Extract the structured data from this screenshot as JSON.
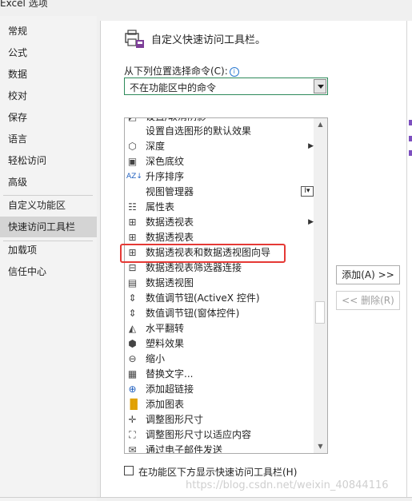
{
  "window": {
    "title": "Excel 选项"
  },
  "sidebar": {
    "items": [
      {
        "label": "常规"
      },
      {
        "label": "公式"
      },
      {
        "label": "数据"
      },
      {
        "label": "校对"
      },
      {
        "label": "保存"
      },
      {
        "label": "语言"
      },
      {
        "label": "轻松访问"
      },
      {
        "label": "高级"
      },
      {
        "label": "自定义功能区"
      },
      {
        "label": "快速访问工具栏",
        "selected": true
      },
      {
        "label": "加载项"
      },
      {
        "label": "信任中心"
      }
    ]
  },
  "main": {
    "heading": "自定义快速访问工具栏。",
    "choose_label": "从下列位置选择命令(C):",
    "dropdown_value": "不在功能区中的命令",
    "commands": [
      {
        "label": "设置/取消阴影",
        "icon": "shadow-icon"
      },
      {
        "label": "设置自选图形的默认效果",
        "icon": "none"
      },
      {
        "label": "深度",
        "icon": "depth-icon",
        "submenu": true
      },
      {
        "label": "深色底纹",
        "icon": "dark-shading-icon"
      },
      {
        "label": "升序排序",
        "icon": "sort-ascending-icon"
      },
      {
        "label": "视图管理器",
        "icon": "none",
        "combo": true
      },
      {
        "label": "属性表",
        "icon": "property-sheet-icon"
      },
      {
        "label": "数据透视表",
        "icon": "pivot-table-icon",
        "submenu": true
      },
      {
        "label": "数据透视表",
        "icon": "pivot-table-icon"
      },
      {
        "label": "数据透视表和数据透视图向导",
        "icon": "pivot-wizard-icon",
        "highlighted": true
      },
      {
        "label": "数据透视表筛选器连接",
        "icon": "pivot-filter-icon"
      },
      {
        "label": "数据透视图",
        "icon": "pivot-chart-icon"
      },
      {
        "label": "数值调节钮(ActiveX 控件)",
        "icon": "spin-button-icon"
      },
      {
        "label": "数值调节钮(窗体控件)",
        "icon": "spin-button-icon"
      },
      {
        "label": "水平翻转",
        "icon": "flip-horizontal-icon"
      },
      {
        "label": "塑料效果",
        "icon": "plastic-effect-icon"
      },
      {
        "label": "缩小",
        "icon": "zoom-out-icon"
      },
      {
        "label": "替换文字...",
        "icon": "alt-text-icon"
      },
      {
        "label": "添加超链接",
        "icon": "hyperlink-icon"
      },
      {
        "label": "添加图表",
        "icon": "chart-icon"
      },
      {
        "label": "调整图形尺寸",
        "icon": "resize-icon"
      },
      {
        "label": "调整图形尺寸以适应内容",
        "icon": "fit-resize-icon"
      },
      {
        "label": "通过电子邮件发送",
        "icon": "email-icon"
      }
    ],
    "add_button": "添加(A) >>",
    "remove_button": "<< 删除(R)",
    "show_below_label": "在功能区下方显示快速访问工具栏(H)"
  },
  "watermark": "https://blog.csdn.net/weixin_40844116",
  "colors": {
    "selected_nav": "#d4d4d4",
    "highlight_box": "#e53935",
    "dropdown_border": "#2e8a5a"
  }
}
